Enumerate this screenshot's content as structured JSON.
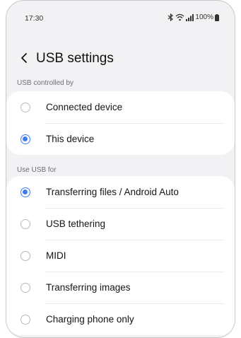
{
  "status_bar": {
    "time": "17:30",
    "battery": "100%"
  },
  "header": {
    "title": "USB settings"
  },
  "sections": {
    "controlled_by": {
      "label": "USB controlled by",
      "options": [
        {
          "label": "Connected device",
          "selected": false
        },
        {
          "label": "This device",
          "selected": true
        }
      ]
    },
    "use_for": {
      "label": "Use USB for",
      "options": [
        {
          "label": "Transferring files / Android Auto",
          "selected": true
        },
        {
          "label": "USB tethering",
          "selected": false
        },
        {
          "label": "MIDI",
          "selected": false
        },
        {
          "label": "Transferring images",
          "selected": false
        },
        {
          "label": "Charging phone only",
          "selected": false
        }
      ]
    }
  },
  "colors": {
    "accent": "#3e7af2",
    "background": "#f2f2f4",
    "card": "#ffffff"
  },
  "icons": {
    "back": "chevron-left-icon",
    "bluetooth": "bluetooth-icon",
    "wifi": "wifi-icon",
    "signal": "signal-icon",
    "battery": "battery-icon"
  }
}
